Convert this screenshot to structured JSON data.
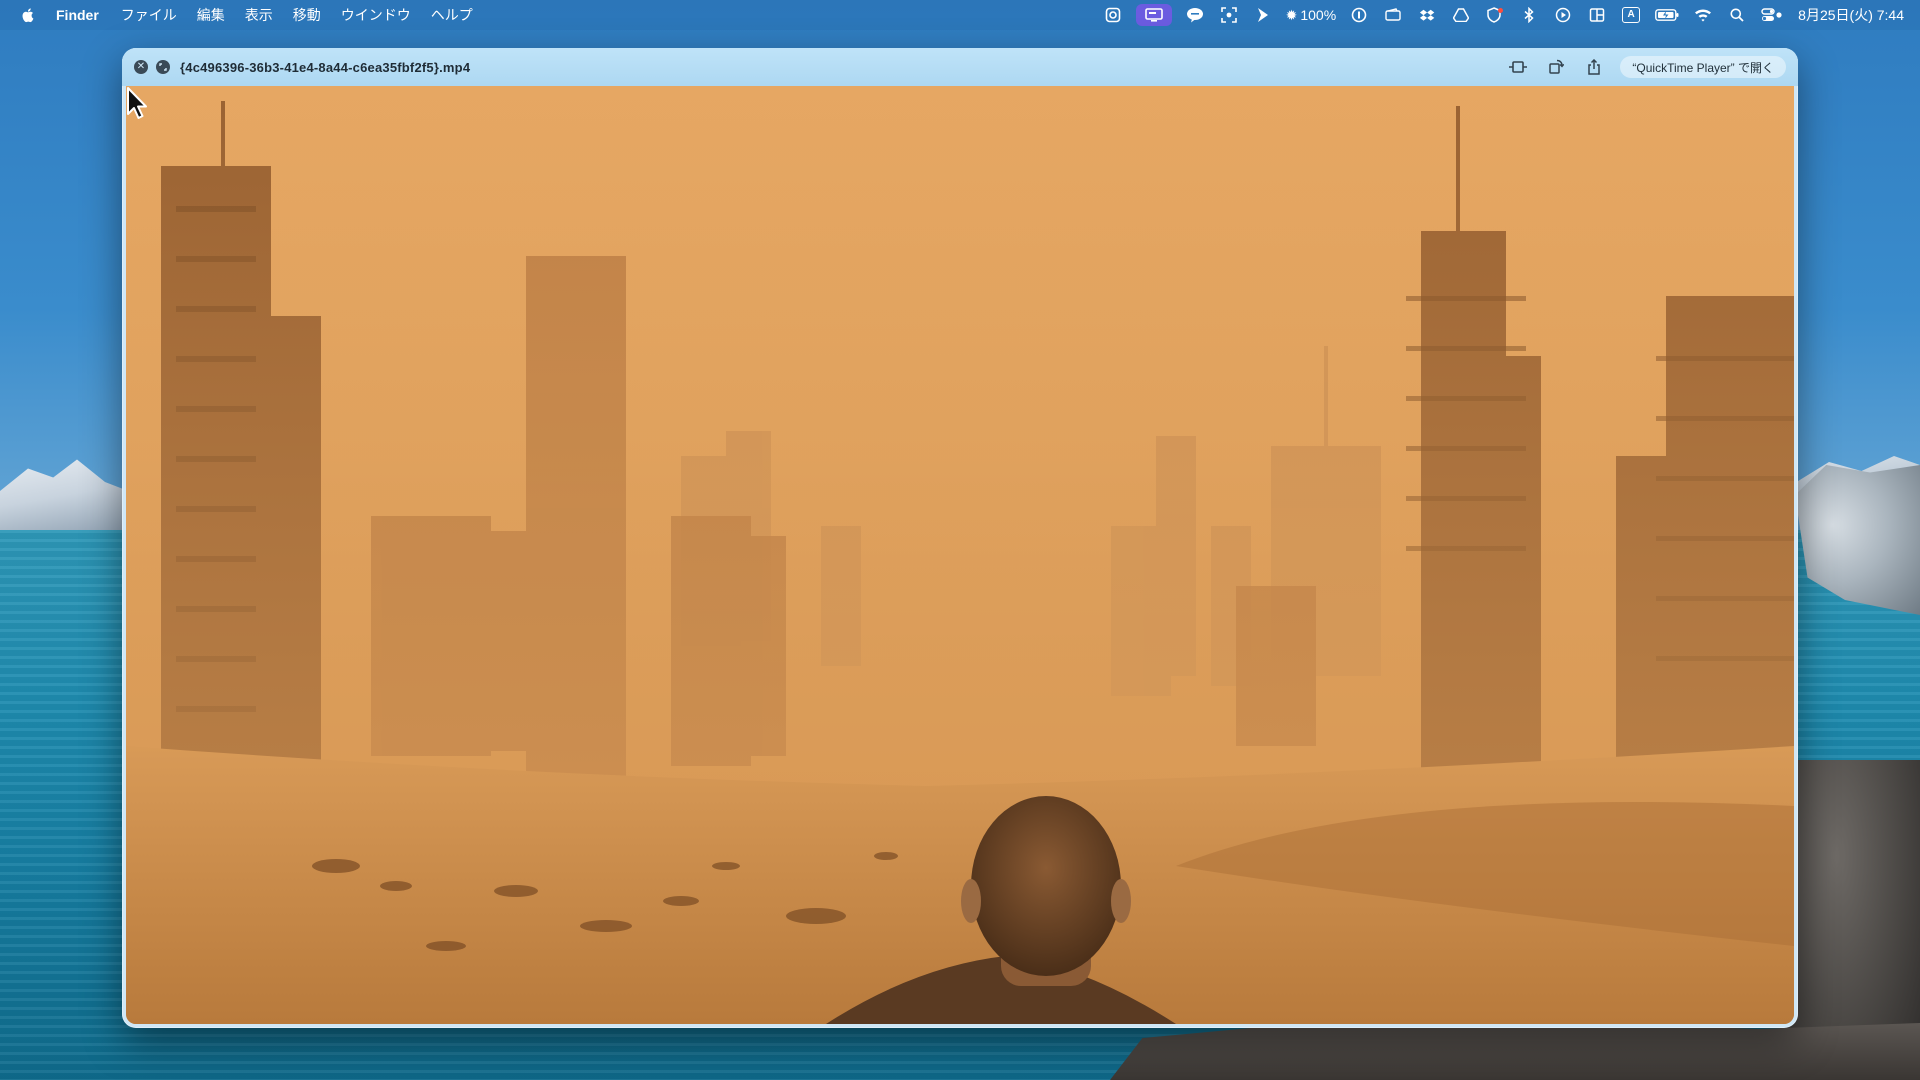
{
  "menubar": {
    "app_name": "Finder",
    "menus": [
      "ファイル",
      "編集",
      "表示",
      "移動",
      "ウインドウ",
      "ヘルプ"
    ],
    "status_icons": [
      "creative-cloud-icon",
      "display-mirror-icon",
      "line-chat-icon",
      "screenshot-icon",
      "shortcut-arrow-icon"
    ],
    "brightness": "100%",
    "status_icons_right": [
      "password-manager-icon",
      "wallet-icon",
      "dropbox-icon",
      "drive-icon",
      "vpn-shield-icon",
      "bluetooth-icon",
      "play-icon",
      "window-layout-icon",
      "input-method-icon",
      "battery-icon",
      "wifi-icon",
      "search-icon",
      "control-center-icon"
    ],
    "input_method_label": "A",
    "clock": "8月25日(火) 7:44"
  },
  "window": {
    "filename": "{4c496396-36b3-41e4-8a44-c6ea35fbf2f5}.mp4",
    "open_with_label": "“QuickTime Player” で開く"
  },
  "colors": {
    "accent_highlight": "#6b5ce0",
    "titlebar": "#b6ddf5",
    "sand": "#d79754"
  }
}
